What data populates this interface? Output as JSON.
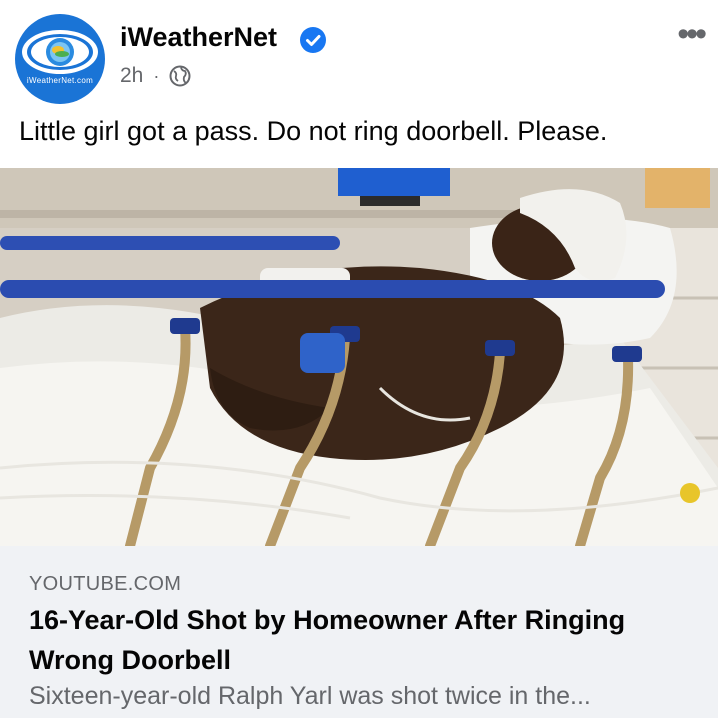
{
  "post": {
    "page_name": "iWeatherNet",
    "avatar_text": "iWeatherNet.com",
    "time": "2h",
    "separator": "·",
    "visibility_icon": "globe-icon",
    "verified_icon": "verified-badge-icon",
    "more_icon": "more-options-icon",
    "more_glyph": "•••",
    "text": "Little girl got a pass. Do not ring doorbell. Please."
  },
  "link_preview": {
    "domain": "YOUTUBE.COM",
    "title": "16-Year-Old Shot by Homeowner After Ringing Wrong Doorbell",
    "description": "Sixteen-year-old Ralph Yarl was shot twice in the..."
  },
  "colors": {
    "brand_blue": "#1a74d6",
    "verified_blue": "#1877f2",
    "secondary_text": "#65676b",
    "card_background": "#f0f2f5"
  }
}
